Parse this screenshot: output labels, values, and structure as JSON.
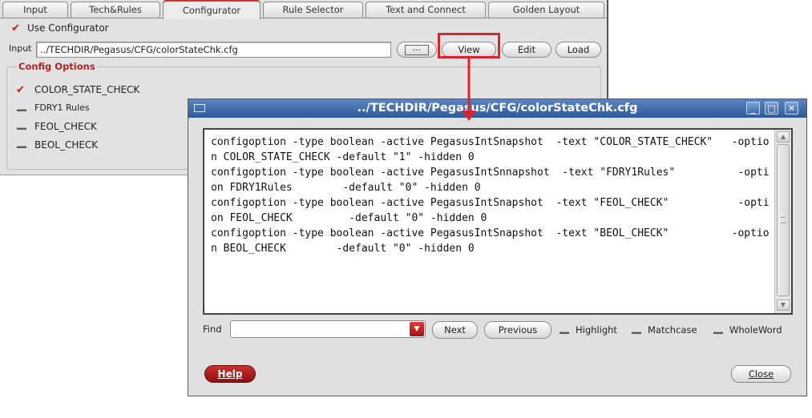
{
  "tabs": [
    "Input",
    "Tech&Rules",
    "Configurator",
    "Rule Selector",
    "Text and Connect",
    "Golden Layout"
  ],
  "active_tab": "Configurator",
  "use_configurator": {
    "label": "Use Configurator",
    "checked": true
  },
  "input_row": {
    "label": "Input",
    "value": "../TECHDIR/Pegasus/CFG/colorStateChk.cfg",
    "browse_label": "...",
    "view_label": "View",
    "edit_label": "Edit",
    "load_label": "Load"
  },
  "config_options": {
    "title": "Config Options",
    "items": [
      {
        "label": "COLOR_STATE_CHECK",
        "checked": true
      },
      {
        "label": "FDRY1 Rules",
        "checked": false
      },
      {
        "label": "FEOL_CHECK",
        "checked": false
      },
      {
        "label": "BEOL_CHECK",
        "checked": false
      }
    ]
  },
  "dialog": {
    "title": "../TECHDIR/Pegasus/CFG/colorStateChk.cfg",
    "window_buttons": [
      "minimize-icon",
      "maximize-icon",
      "close-icon"
    ],
    "content": "configoption -type boolean -active PegasusIntSnapshot  -text \"COLOR_STATE_CHECK\"   -option COLOR_STATE_CHECK -default \"1\" -hidden 0\nconfigoption -type boolean -active PegasusIntSnnapshot  -text \"FDRY1Rules\"          -option FDRY1Rules        -default \"0\" -hidden 0\nconfigoption -type boolean -active PegasusIntSnapshot  -text \"FEOL_CHECK\"           -option FEOL_CHECK         -default \"0\" -hidden 0\nconfigoption -type boolean -active PegasusIntSnapshot  -text \"BEOL_CHECK\"          -option BEOL_CHECK        -default \"0\" -hidden 0",
    "find": {
      "label": "Find",
      "value": "",
      "next_label": "Next",
      "previous_label": "Previous",
      "highlight_label": "Highlight",
      "matchcase_label": "Matchcase",
      "wholeword_label": "WholeWord"
    },
    "help_label": "Help",
    "close_label": "Close"
  },
  "colors": {
    "accent_red": "#d9232e",
    "title_blue": "#3a68a8",
    "panel_gray": "#e2e2e2"
  }
}
